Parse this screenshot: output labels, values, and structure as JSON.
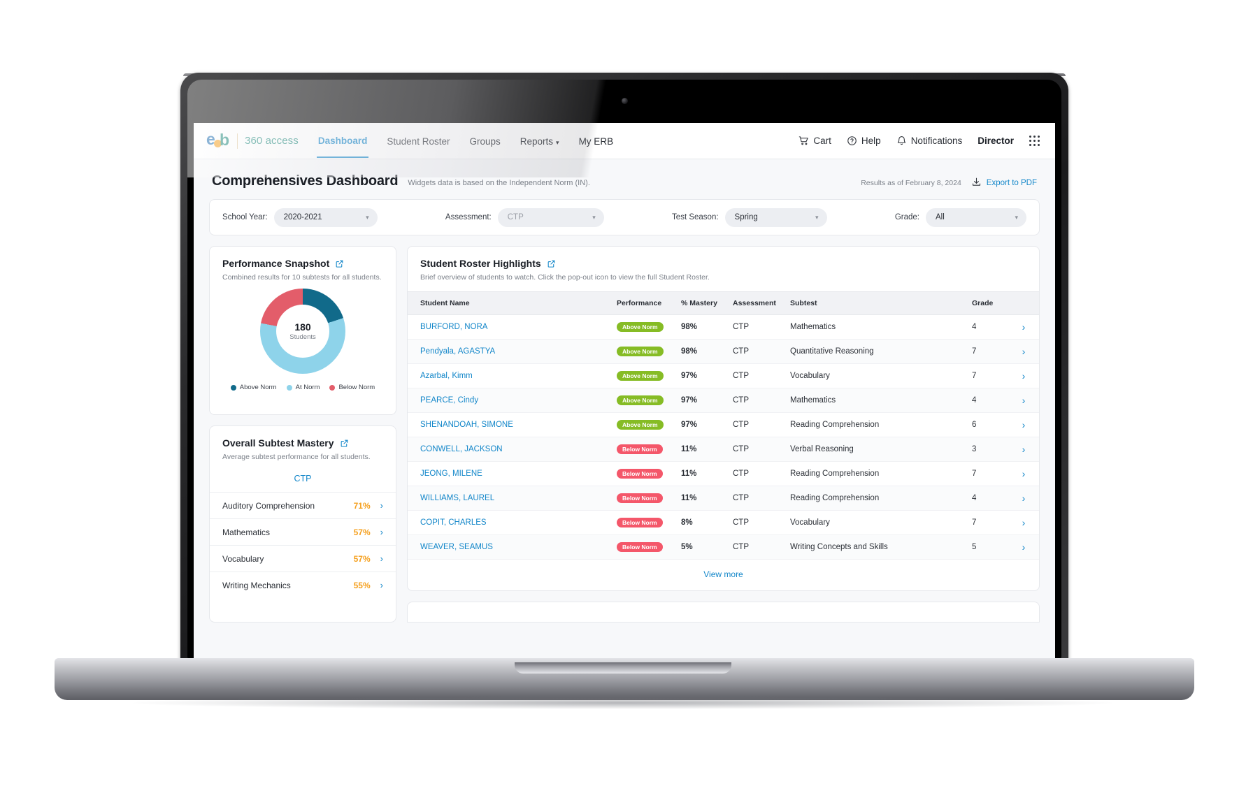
{
  "brand": {
    "logo_initials": "erb",
    "product_name": "360 access",
    "colors": {
      "primary": "#1286c9",
      "teal": "#1f8a7d",
      "orange": "#f5a01e",
      "above_norm": "#86bc25",
      "below_norm": "#f4576a",
      "dark_teal": "#116a8a",
      "light_blue": "#8ed3ea"
    }
  },
  "nav": {
    "links": [
      {
        "label": "Dashboard",
        "active": true
      },
      {
        "label": "Student Roster",
        "active": false
      },
      {
        "label": "Groups",
        "active": false
      },
      {
        "label": "Reports",
        "active": false,
        "has_caret": true
      },
      {
        "label": "My ERB",
        "active": false
      }
    ],
    "actions": [
      {
        "label": "Cart",
        "icon": "cart-icon"
      },
      {
        "label": "Help",
        "icon": "question-circle-icon"
      },
      {
        "label": "Notifications",
        "icon": "bell-icon"
      }
    ],
    "user_role": "Director",
    "app_switcher_icon": "grid-apps-icon"
  },
  "header": {
    "title": "Comprehensives Dashboard",
    "subtitle": "Widgets data is based on the Independent Norm (IN).",
    "results_as_of": "Results as of February 8, 2024",
    "export_label": "Export to PDF",
    "export_icon": "download-icon"
  },
  "filters": [
    {
      "label": "School Year:",
      "value": "2020-2021",
      "muted": false
    },
    {
      "label": "Assessment:",
      "value": "CTP",
      "muted": true
    },
    {
      "label": "Test Season:",
      "value": "Spring",
      "muted": false
    },
    {
      "label": "Grade:",
      "value": "All",
      "muted": false
    }
  ],
  "performance_snapshot": {
    "title": "Performance Snapshot",
    "subtitle": "Combined results for 10 subtests for all students.",
    "center_value": "180",
    "center_label": "Students",
    "popout_icon": "popout-icon"
  },
  "chart_data": {
    "type": "pie",
    "title": "Performance Snapshot",
    "subtitle": "Combined results for 10 subtests for all students.",
    "center_value": 180,
    "center_label": "Students",
    "categories": [
      "Above Norm",
      "At Norm",
      "Below Norm"
    ],
    "values": [
      36,
      104,
      40
    ],
    "percentages": [
      20,
      58,
      22
    ],
    "colors": [
      "#116a8a",
      "#8ed3ea",
      "#e35d6a"
    ],
    "legend_position": "bottom",
    "donut": true
  },
  "subtest_mastery": {
    "title": "Overall Subtest Mastery",
    "subtitle": "Average subtest performance for all students.",
    "assessment": "CTP",
    "popout_icon": "popout-icon",
    "rows": [
      {
        "name": "Auditory Comprehension",
        "pct": "71%"
      },
      {
        "name": "Mathematics",
        "pct": "57%"
      },
      {
        "name": "Vocabulary",
        "pct": "57%"
      },
      {
        "name": "Writing Mechanics",
        "pct": "55%"
      }
    ]
  },
  "roster": {
    "title": "Student Roster Highlights",
    "subtitle": "Brief overview of students to watch. Click the pop-out icon to view the full Student Roster.",
    "popout_icon": "popout-icon",
    "columns": [
      "Student Name",
      "Performance",
      "% Mastery",
      "Assessment",
      "Subtest",
      "Grade",
      ""
    ],
    "rows": [
      {
        "name": "BURFORD, NORA",
        "performance": "Above Norm",
        "level": "above",
        "mastery": "98%",
        "assessment": "CTP",
        "subtest": "Mathematics",
        "grade": "4"
      },
      {
        "name": "Pendyala, AGASTYA",
        "performance": "Above Norm",
        "level": "above",
        "mastery": "98%",
        "assessment": "CTP",
        "subtest": "Quantitative Reasoning",
        "grade": "7"
      },
      {
        "name": "Azarbal, Kimm",
        "performance": "Above Norm",
        "level": "above",
        "mastery": "97%",
        "assessment": "CTP",
        "subtest": "Vocabulary",
        "grade": "7"
      },
      {
        "name": "PEARCE, Cindy",
        "performance": "Above Norm",
        "level": "above",
        "mastery": "97%",
        "assessment": "CTP",
        "subtest": "Mathematics",
        "grade": "4"
      },
      {
        "name": "SHENANDOAH, SIMONE",
        "performance": "Above Norm",
        "level": "above",
        "mastery": "97%",
        "assessment": "CTP",
        "subtest": "Reading Comprehension",
        "grade": "6"
      },
      {
        "name": "CONWELL, JACKSON",
        "performance": "Below Norm",
        "level": "below",
        "mastery": "11%",
        "assessment": "CTP",
        "subtest": "Verbal Reasoning",
        "grade": "3"
      },
      {
        "name": "JEONG, MILENE",
        "performance": "Below Norm",
        "level": "below",
        "mastery": "11%",
        "assessment": "CTP",
        "subtest": "Reading Comprehension",
        "grade": "7"
      },
      {
        "name": "WILLIAMS, LAUREL",
        "performance": "Below Norm",
        "level": "below",
        "mastery": "11%",
        "assessment": "CTP",
        "subtest": "Reading Comprehension",
        "grade": "4"
      },
      {
        "name": "COPIT, CHARLES",
        "performance": "Below Norm",
        "level": "below",
        "mastery": "8%",
        "assessment": "CTP",
        "subtest": "Vocabulary",
        "grade": "7"
      },
      {
        "name": "WEAVER, SEAMUS",
        "performance": "Below Norm",
        "level": "below",
        "mastery": "5%",
        "assessment": "CTP",
        "subtest": "Writing Concepts and Skills",
        "grade": "5"
      }
    ],
    "view_more_label": "View more"
  }
}
